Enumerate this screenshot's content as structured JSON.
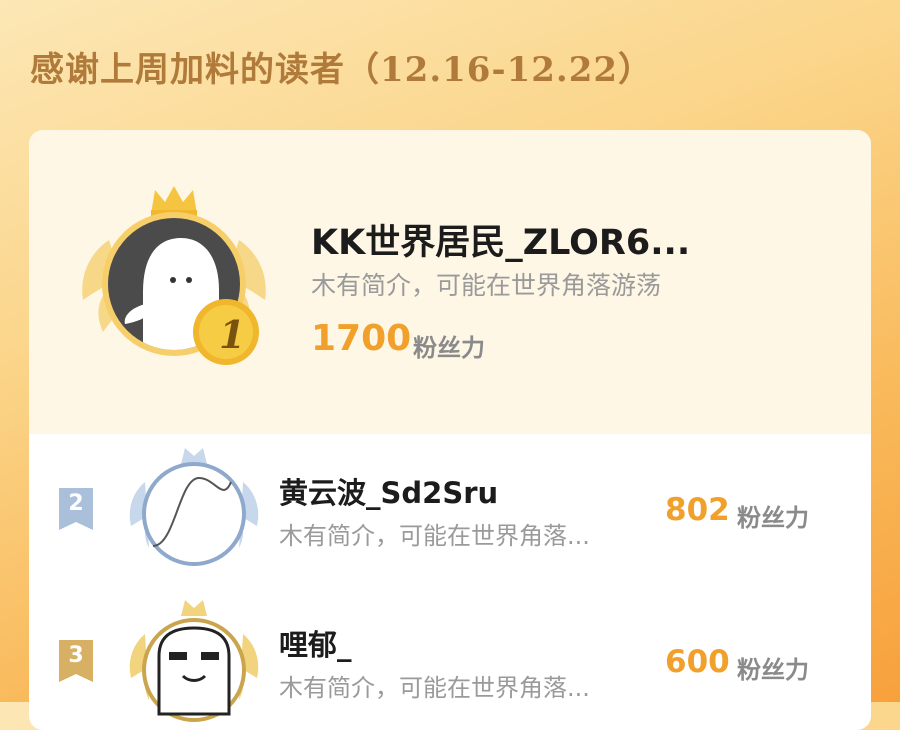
{
  "header": {
    "title": "感谢上周加料的读者（12.16-12.22）"
  },
  "colors": {
    "accent": "#f1a02b",
    "gold": "#f2c04a",
    "silver": "#9fb5cf",
    "bronze": "#cfa24f",
    "name": "#1c1c1c",
    "bio": "#9a9a9a"
  },
  "fans_unit": "粉丝力",
  "ranking": [
    {
      "rank": "1",
      "name": "KK世界居民_ZLOR6...",
      "bio": "木有简介，可能在世界角落游荡",
      "fans": "1700",
      "avatar_icon": "ghost-avatar-icon",
      "badge_icon": "gold-medal-icon"
    },
    {
      "rank": "2",
      "name": "黄云波_Sd2Sru",
      "bio": "木有简介，可能在世界角落...",
      "fans": "802",
      "avatar_icon": "sine-wave-avatar-icon",
      "badge_icon": "silver-ribbon-icon"
    },
    {
      "rank": "3",
      "name": "哩郁_",
      "bio": "木有简介，可能在世界角落...",
      "fans": "600",
      "avatar_icon": "smug-face-avatar-icon",
      "badge_icon": "bronze-ribbon-icon"
    }
  ]
}
